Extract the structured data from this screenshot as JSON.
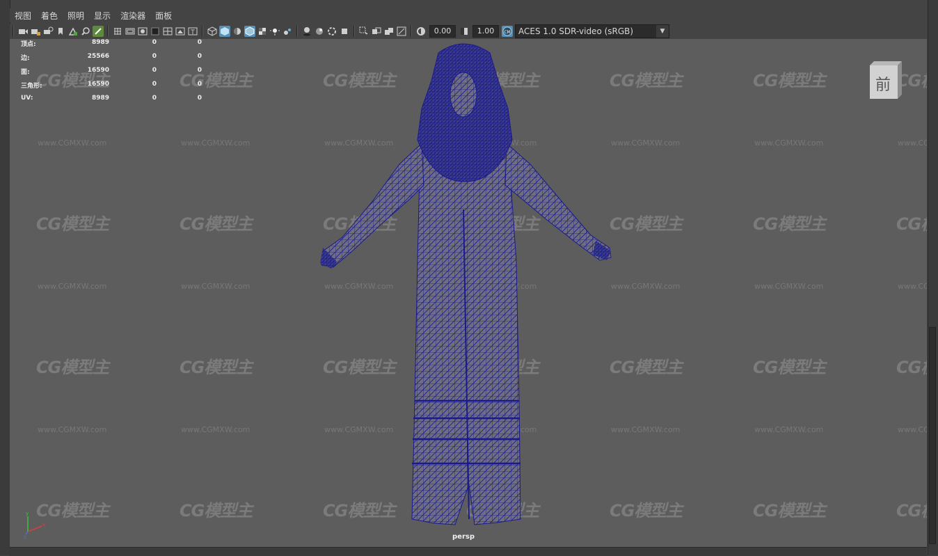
{
  "menu": {
    "items": [
      "视图",
      "着色",
      "照明",
      "显示",
      "渲染器",
      "面板"
    ]
  },
  "toolbar": {
    "exposure_value": "0.00",
    "gamma_value": "1.00",
    "color_management": "ACES 1.0 SDR-video (sRGB)"
  },
  "stats": {
    "rows": [
      {
        "label": "顶点:",
        "v1": "8989",
        "v2": "0",
        "v3": "0"
      },
      {
        "label": "边:",
        "v1": "25566",
        "v2": "0",
        "v3": "0"
      },
      {
        "label": "面:",
        "v1": "16590",
        "v2": "0",
        "v3": "0"
      },
      {
        "label": "三角形:",
        "v1": "16590",
        "v2": "0",
        "v3": "0"
      },
      {
        "label": "UV:",
        "v1": "8989",
        "v2": "0",
        "v3": "0"
      }
    ]
  },
  "viewcube": {
    "face_label": "前"
  },
  "camera_label": "persp",
  "watermark": {
    "logo": "CG模型主",
    "url": "www.CGMXW.com"
  },
  "colors": {
    "viewport_bg": "#5d5d5d",
    "wireframe": "#1a1a8c",
    "mesh_fill": "#6e6d82",
    "accent_toggle": "#5a8fb5"
  },
  "icons": {
    "toolbar": [
      "camera-icon",
      "camera-lock-icon",
      "camera-attrs-icon",
      "bookmark-icon",
      "image-plane-icon",
      "pan-zoom-icon",
      "grease-pencil-icon",
      "grid-icon",
      "film-gate-icon",
      "resolution-gate-icon",
      "gate-mask-icon",
      "field-chart-icon",
      "safe-action-icon",
      "safe-title-icon",
      "wireframe-icon",
      "smooth-shade-icon",
      "default-material-icon",
      "wireframe-on-shaded-icon",
      "xray-icon",
      "textured-icon",
      "lights-icon",
      "shadows-icon",
      "screen-space-ao-icon",
      "motion-blur-icon",
      "anti-alias-icon",
      "depth-of-field-icon",
      "isolate-select-icon",
      "xray-joints-icon",
      "xray-active-icon",
      "backface-icon",
      "exposure-icon",
      "gamma-icon",
      "color-management-icon"
    ]
  }
}
